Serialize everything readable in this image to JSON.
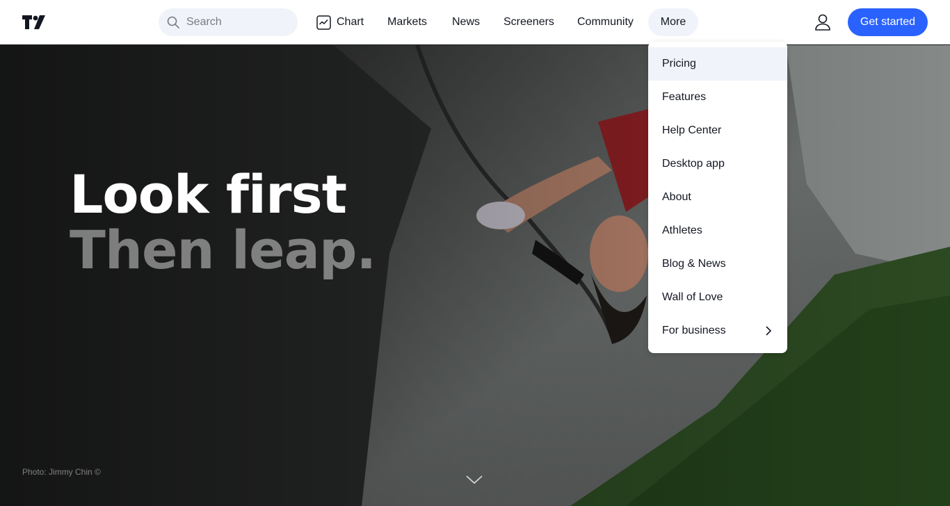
{
  "header": {
    "search": {
      "placeholder": "Search"
    },
    "nav": [
      {
        "label": "Chart",
        "icon": "chart-icon"
      },
      {
        "label": "Markets"
      },
      {
        "label": "News"
      },
      {
        "label": "Screeners"
      },
      {
        "label": "Community"
      },
      {
        "label": "More",
        "active": true
      }
    ],
    "cta_label": "Get started",
    "accent_color": "#2962ff"
  },
  "hero": {
    "headline_line1": "Look first",
    "headline_line2": "Then leap.",
    "photo_credit": "Photo: Jimmy Chin ©"
  },
  "more_menu": {
    "items": [
      {
        "label": "Pricing",
        "hovered": true
      },
      {
        "label": "Features"
      },
      {
        "label": "Help Center"
      },
      {
        "label": "Desktop app"
      },
      {
        "label": "About"
      },
      {
        "label": "Athletes"
      },
      {
        "label": "Blog & News"
      },
      {
        "label": "Wall of Love"
      },
      {
        "label": "For business",
        "has_submenu": true
      }
    ]
  }
}
